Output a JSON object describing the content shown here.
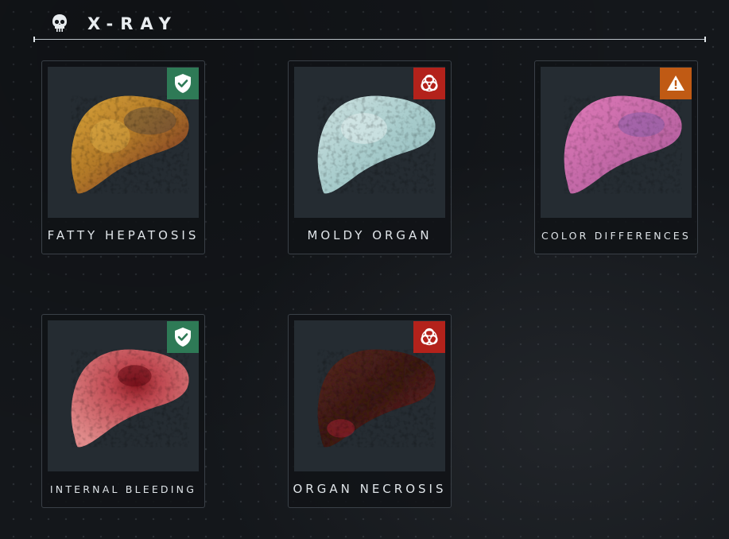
{
  "header": {
    "title": "X-RAY",
    "icon": "skull-icon"
  },
  "colors": {
    "status_ok": "#2e7a56",
    "status_biohazard": "#b3221b",
    "status_warning": "#c05a14"
  },
  "cards": [
    {
      "label": "FATTY HEPATOSIS",
      "status": "ok",
      "status_icon": "shield-check-icon",
      "liver": "yellow-fatty"
    },
    {
      "label": "MOLDY ORGAN",
      "status": "biohazard",
      "status_icon": "biohazard-icon",
      "liver": "pale-cyan-moldy"
    },
    {
      "label": "COLOR DIFFERENCES",
      "status": "warning",
      "status_icon": "warning-icon",
      "liver": "pink-purple"
    },
    {
      "label": "INTERNAL BLEEDING",
      "status": "ok",
      "status_icon": "shield-check-icon",
      "liver": "red-bleeding"
    },
    {
      "label": "ORGAN NECROSIS",
      "status": "biohazard",
      "status_icon": "biohazard-icon",
      "liver": "dark-necrotic"
    }
  ]
}
